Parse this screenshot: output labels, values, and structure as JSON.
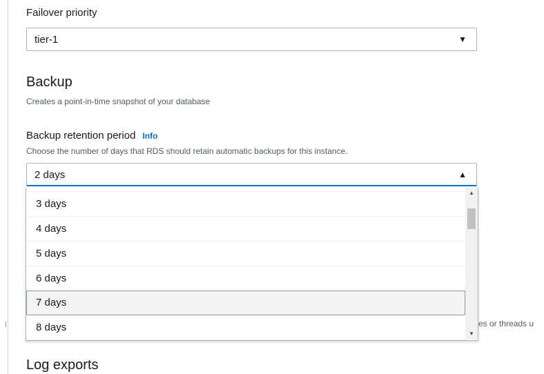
{
  "failover": {
    "label": "Failover priority",
    "value": "tier-1",
    "caret": "▼"
  },
  "backup": {
    "title": "Backup",
    "description": "Creates a point-in-time snapshot of your database",
    "retention": {
      "label": "Backup retention period",
      "info": "Info",
      "description": "Choose the number of days that RDS should retain automatic backups for this instance.",
      "value": "2 days",
      "caret": "▲",
      "options": [
        "3 days",
        "4 days",
        "5 days",
        "6 days",
        "7 days",
        "8 days"
      ],
      "hovered_option": "7 days",
      "scroll_up": "▲",
      "scroll_down": "▼"
    }
  },
  "background_text": "es or threads u",
  "log_exports": {
    "title": "Log exports"
  }
}
